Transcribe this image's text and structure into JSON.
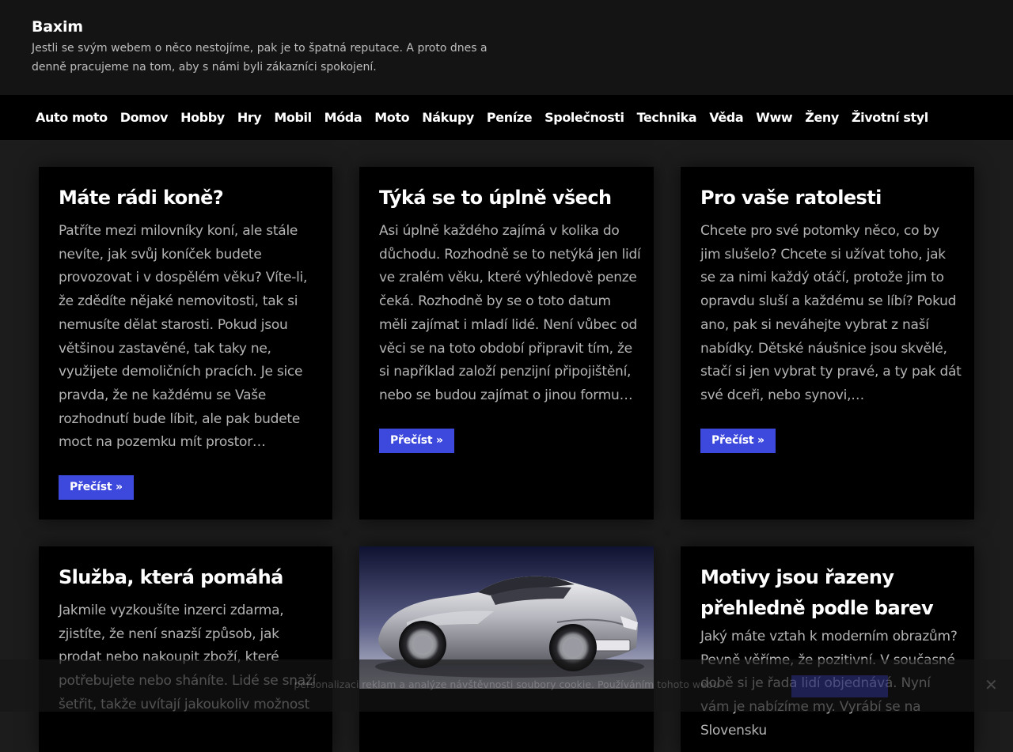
{
  "header": {
    "title": "Baxim",
    "description": "Jestli se svým webem o něco nestojíme, pak je to špatná reputace. A proto dnes a denně pracujeme na tom, aby s námi byli zákazníci spokojení."
  },
  "nav": {
    "items": [
      "Auto moto",
      "Domov",
      "Hobby",
      "Hry",
      "Mobil",
      "Móda",
      "Moto",
      "Nákupy",
      "Peníze",
      "Společnosti",
      "Technika",
      "Věda",
      "Www",
      "Ženy",
      "Životní styl"
    ]
  },
  "read_more_label": "Přečíst »",
  "cards": [
    {
      "title": "Máte rádi koně?",
      "text": "Patříte mezi milovníky koní, ale stále nevíte, jak svůj koníček budete provozovat i v dospělém věku? Víte-li, že zdědíte nějaké nemovitosti, tak si nemusíte dělat starosti. Pokud jsou většinou zastavěné, tak taky ne, využijete demoličních pracích. Je sice pravda, že ne každému se Vaše rozhodnutí bude líbit, ale pak budete moct na pozemku mít prostor…"
    },
    {
      "title": "Týká se to úplně všech",
      "text": "Asi úplně každého zajímá v kolika do důchodu. Rozhodně se to netýká jen lidí ve zralém věku, které výhledově penze čeká. Rozhodně by se o toto datum měli zajímat i mladí lidé. Není vůbec od věci se na toto období připravit tím, že si například založí penzijní připojištění, nebo se budou zajímat o jinou formu…"
    },
    {
      "title": "Pro vaše ratolesti",
      "text": "Chcete pro své potomky něco, co by jim slušelo? Chcete si užívat toho, jak se za nimi každý otáčí, protože jim to opravdu sluší a každému se líbí? Pokud ano, pak si neváhejte vybrat z naší nabídky. Dětské náušnice jsou skvělé, stačí si jen vybrat ty pravé, a ty pak dát své dceři, nebo synovi,…"
    },
    {
      "title": "Služba, která pomáhá",
      "text": "Jakmile vyzkoušíte inzerci zdarma, zjistíte, že není snazší způsob, jak prodat nebo nakoupit zboží, které potřebujete nebo sháníte. Lidé se snaží šetřit, takže uvítají jakoukoliv možnost"
    },
    {
      "title": "Motivy jsou řazeny přehledně podle barev",
      "text": "Jaký máte vztah k moderním obrazům? Pevně věříme, že pozitivní. V současné době si je řada lidí objednává. Nyní vám je nabízíme my. Vyrábí se na Slovensku"
    }
  ],
  "cookie": {
    "text": "personalizaci reklam a analýze návštěvnosti soubory cookie. Používáním tohoto webu",
    "accept": "",
    "close": "✕"
  },
  "colors": {
    "accent": "#3d48dd",
    "card_bg": "#000000",
    "page_bg": "#1c1c1c",
    "header_bg": "#141414"
  }
}
